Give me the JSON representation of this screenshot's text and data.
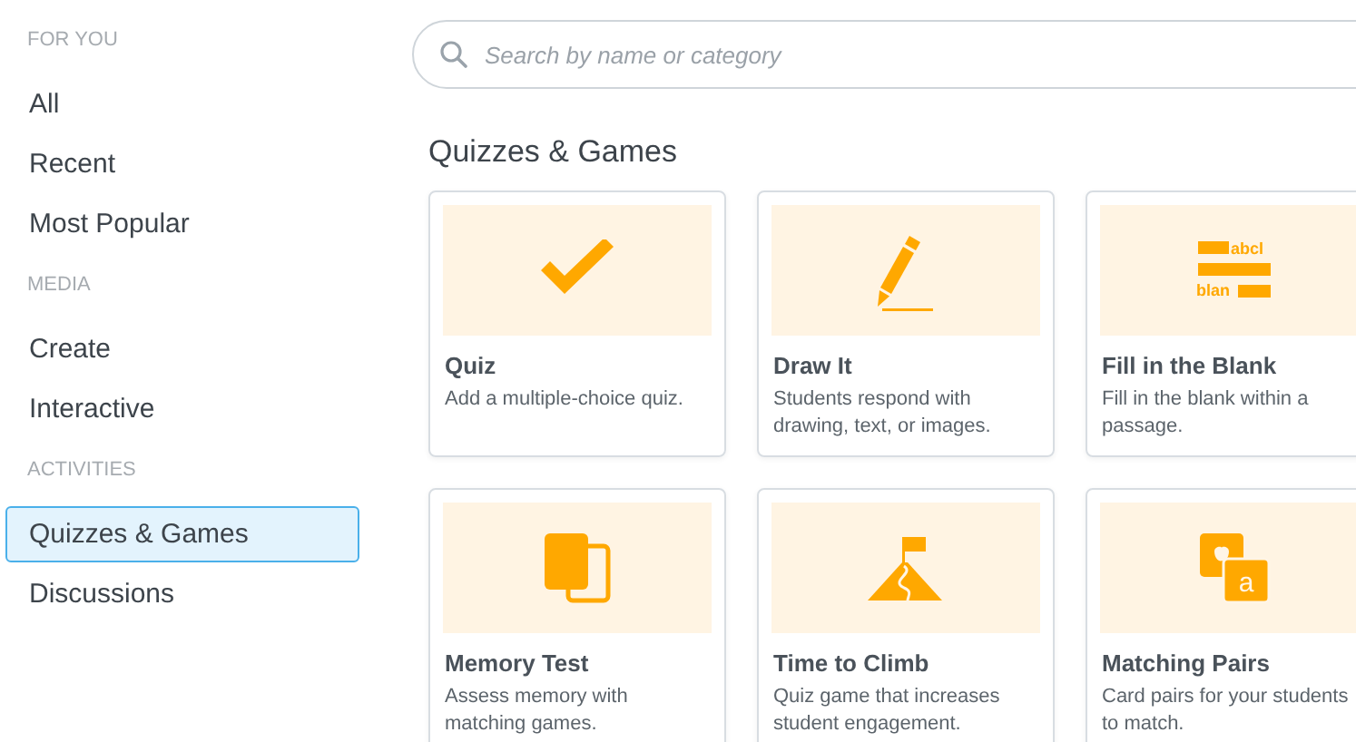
{
  "sidebar": {
    "sections": [
      {
        "heading": "FOR YOU",
        "items": [
          {
            "label": "All",
            "selected": false
          },
          {
            "label": "Recent",
            "selected": false
          },
          {
            "label": "Most Popular",
            "selected": false
          }
        ]
      },
      {
        "heading": "MEDIA",
        "items": [
          {
            "label": "Create",
            "selected": false
          },
          {
            "label": "Interactive",
            "selected": false
          }
        ]
      },
      {
        "heading": "ACTIVITIES",
        "items": [
          {
            "label": "Quizzes & Games",
            "selected": true
          },
          {
            "label": "Discussions",
            "selected": false
          }
        ]
      }
    ]
  },
  "search": {
    "placeholder": "Search by name or category"
  },
  "heading": "Quizzes & Games",
  "cards": [
    {
      "kind": "check",
      "title": "Quiz",
      "description": "Add a multiple-choice quiz."
    },
    {
      "kind": "pencil",
      "title": "Draw It",
      "description": "Students respond with drawing, text, or images."
    },
    {
      "kind": "blanks",
      "title": "Fill in the Blank",
      "description": "Fill in the blank within a passage.",
      "icon_texts": [
        "abcl",
        "blan"
      ]
    },
    {
      "kind": "cards",
      "title": "Memory Test",
      "description": "Assess memory with matching games."
    },
    {
      "kind": "mountain",
      "title": "Time to Climb",
      "description": "Quiz game that increases student engagement."
    },
    {
      "kind": "pairs",
      "title": "Matching Pairs",
      "description": "Card pairs for your students to match.",
      "icon_texts": [
        "a"
      ]
    }
  ]
}
